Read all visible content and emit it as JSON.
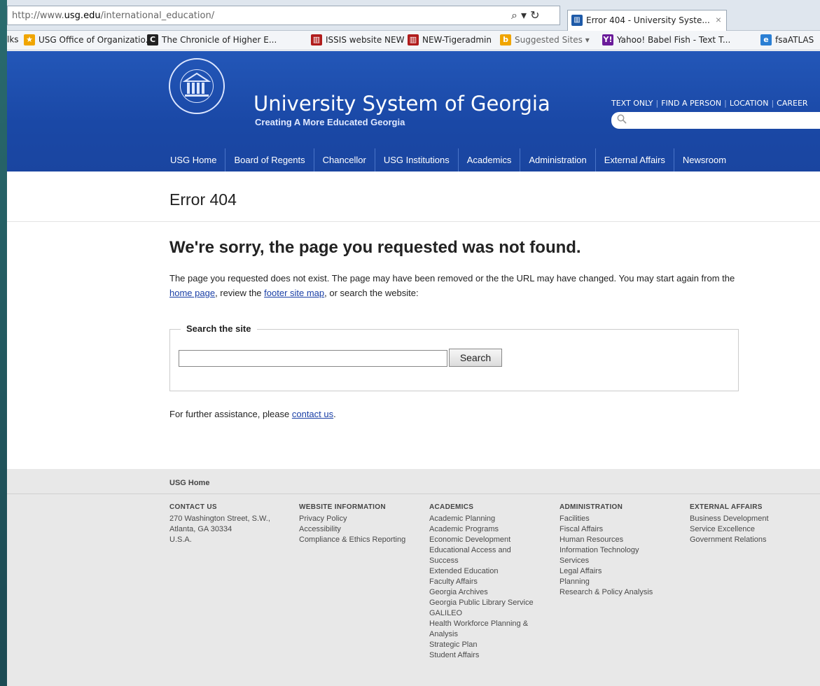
{
  "browser": {
    "url_prefix": "http://www.",
    "url_domain": "usg.edu",
    "url_path": "/international_education/",
    "tab_title": "Error 404 - University Syste...",
    "tab_close": "×",
    "addr_controls": "⌕ ▾ ↻",
    "favorites": [
      {
        "label": "lks",
        "icon": "",
        "color": "transparent"
      },
      {
        "label": "USG Office of Organizatio...",
        "icon": "★",
        "color": "#f0a500"
      },
      {
        "label": "The Chronicle of Higher E...",
        "icon": "C",
        "color": "#222"
      },
      {
        "label": "ISSIS website NEW",
        "icon": "▥",
        "color": "#b01c1c"
      },
      {
        "label": "NEW-Tigeradmin",
        "icon": "▥",
        "color": "#b01c1c"
      },
      {
        "label": "Suggested Sites ▾",
        "icon": "b",
        "color": "#f0a500"
      },
      {
        "label": "Yahoo! Babel Fish - Text T...",
        "icon": "Y!",
        "color": "#6a1b9a"
      },
      {
        "label": "fsaATLAS",
        "icon": "e",
        "color": "#2a7fd4"
      }
    ]
  },
  "header": {
    "site_title": "University System of Georgia",
    "tagline": "Creating A More Educated Georgia",
    "util_links": [
      "TEXT ONLY",
      "FIND A PERSON",
      "LOCATION",
      "CAREER"
    ],
    "search_icon": "search-icon",
    "nav": [
      "USG Home",
      "Board of Regents",
      "Chancellor",
      "USG Institutions",
      "Academics",
      "Administration",
      "External Affairs",
      "Newsroom"
    ]
  },
  "page": {
    "title": "Error 404",
    "headline": "We're sorry, the page you requested was not found.",
    "body_part1": "The page you requested does not exist. The page may have been removed or the the URL may have changed. You may start again from the ",
    "link_home": "home page",
    "body_part2": ", review the ",
    "link_sitemap": "footer site map",
    "body_part3": ", or search the website:",
    "search_legend": "Search the site",
    "search_value": "",
    "search_button": "Search",
    "assist_text": "For further assistance, please ",
    "assist_link": "contact us",
    "assist_end": "."
  },
  "footer": {
    "home": "USG Home",
    "columns": [
      {
        "heading": "CONTACT US",
        "items": [
          "270 Washington Street, S.W.,",
          "Atlanta, GA 30334",
          "U.S.A."
        ]
      },
      {
        "heading": "WEBSITE INFORMATION",
        "items": [
          "Privacy Policy",
          "Accessibility",
          "Compliance & Ethics Reporting"
        ]
      },
      {
        "heading": "ACADEMICS",
        "items": [
          "Academic Planning",
          "Academic Programs",
          "Economic Development",
          "Educational Access and",
          "Success",
          "Extended Education",
          "Faculty Affairs",
          "Georgia Archives",
          "Georgia Public Library Service",
          "GALILEO",
          "Health Workforce Planning &",
          "Analysis",
          "Strategic Plan",
          "Student Affairs"
        ]
      },
      {
        "heading": "ADMINISTRATION",
        "items": [
          "Facilities",
          "Fiscal Affairs",
          "Human Resources",
          "Information Technology",
          "Services",
          "Legal Affairs",
          "Planning",
          "Research & Policy Analysis"
        ]
      },
      {
        "heading": "EXTERNAL AFFAIRS",
        "items": [
          "Business Development",
          "Service Excellence",
          "Government Relations"
        ]
      }
    ]
  }
}
